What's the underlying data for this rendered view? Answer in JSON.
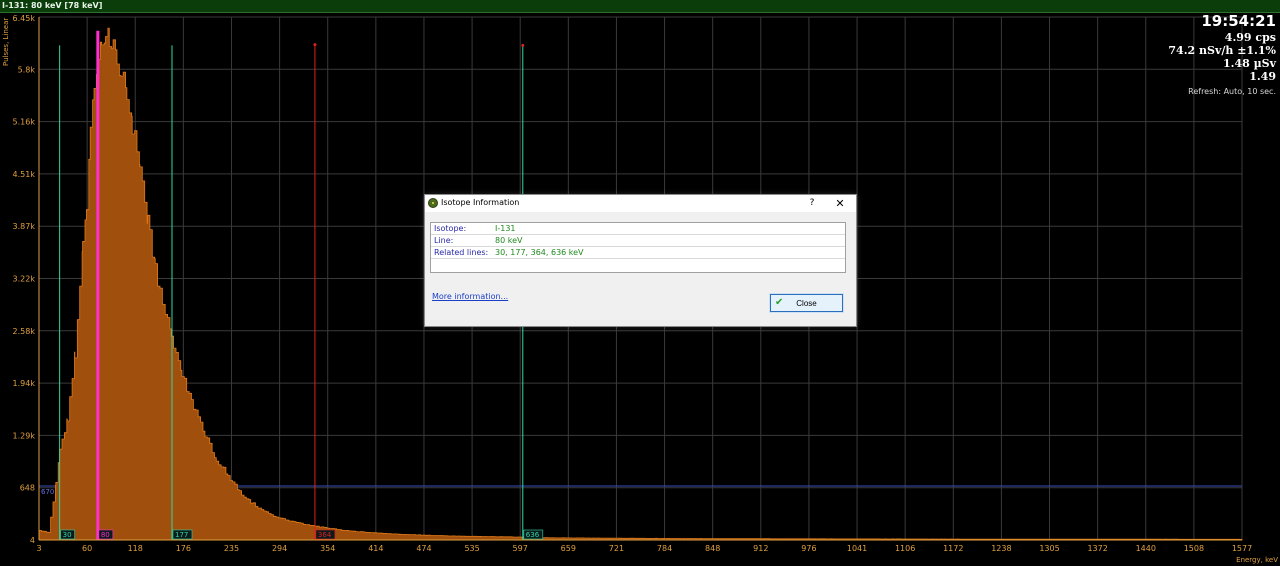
{
  "window": {
    "title": "I-131: 80 keV [78 keV]"
  },
  "stats": {
    "time": "19:54:21",
    "cps": "4.99 cps",
    "dose_rate": "74.2 nSv/h ±1.1%",
    "dose": "1.48 µSv",
    "ratio": "1.49",
    "refresh": "Refresh: Auto, 10 sec."
  },
  "dialog": {
    "title": "Isotope Information",
    "help_label": "?",
    "close_label": "✕",
    "rows": [
      {
        "label": "Isotope:",
        "value": "I-131"
      },
      {
        "label": "Line:",
        "value": "80 keV"
      },
      {
        "label": "Related lines:",
        "value": "30, 177, 364, 636 keV"
      }
    ],
    "more_link": "More information...",
    "close_button": "Close",
    "icon": "radiation-isotope-icon"
  },
  "chart_data": {
    "type": "area",
    "title": "",
    "xlabel": "Energy, keV",
    "ylabel": "Pulses, Linear",
    "xlim": [
      3,
      1577
    ],
    "ylim": [
      4,
      6450
    ],
    "x_ticks": [
      "3",
      "60",
      "118",
      "176",
      "235",
      "294",
      "354",
      "414",
      "474",
      "535",
      "597",
      "659",
      "721",
      "784",
      "848",
      "912",
      "976",
      "1041",
      "1106",
      "1172",
      "1238",
      "1305",
      "1372",
      "1440",
      "1508",
      "1577"
    ],
    "y_ticks": [
      "4",
      "648",
      "1.29k",
      "1.94k",
      "2.58k",
      "3.22k",
      "3.87k",
      "4.51k",
      "5.16k",
      "5.8k",
      "6.45k"
    ],
    "grid": true,
    "series": [
      {
        "values_x": [
          3,
          15,
          25,
          30,
          40,
          50,
          60,
          65,
          70,
          75,
          80,
          85,
          90,
          95,
          100,
          105,
          110,
          118,
          125,
          135,
          145,
          155,
          165,
          176,
          190,
          205,
          220,
          235,
          250,
          265,
          280,
          294,
          310,
          330,
          354,
          380,
          414,
          445,
          474,
          535,
          597,
          636,
          659,
          721,
          784,
          848,
          912,
          976,
          1041,
          1106,
          1172,
          1238,
          1305,
          1372,
          1440,
          1508,
          1577
        ],
        "values_y": [
          120,
          100,
          700,
          1100,
          1500,
          2300,
          3600,
          4200,
          4950,
          5500,
          5950,
          6250,
          6300,
          6200,
          6150,
          6000,
          5800,
          5500,
          5100,
          4500,
          3900,
          3350,
          2900,
          2550,
          2050,
          1650,
          1300,
          1000,
          800,
          600,
          470,
          380,
          300,
          240,
          190,
          150,
          110,
          90,
          75,
          55,
          45,
          40,
          32,
          28,
          25,
          22,
          20,
          19,
          18,
          17,
          16,
          15,
          15,
          14,
          14,
          13,
          12
        ]
      }
    ],
    "markers": [
      {
        "energy": 30,
        "label": "30",
        "color": "#2fd8a8",
        "top_value": 6100,
        "bottom_value": 350
      },
      {
        "energy": 80,
        "label": "80",
        "color": "#ff2fd0",
        "top_value": 6280,
        "bottom_value": 4
      },
      {
        "energy": 177,
        "label": "177",
        "color": "#2fd8a8",
        "top_value": 6100,
        "bottom_value": 4
      },
      {
        "energy": 364,
        "label": "364",
        "color": "#e02020",
        "top_value": 6110,
        "bottom_value": 4
      },
      {
        "energy": 636,
        "label": "636",
        "color": "#2fd8a8",
        "top_value": 6100,
        "bottom_value": 580
      }
    ],
    "threshold": {
      "value": 670,
      "label": "670",
      "color": "#3b4fc0"
    },
    "colors": {
      "fill": "#a04f0c",
      "stroke": "#e07a1a",
      "axis": "#e0a040",
      "grid": "#3a3a3a"
    }
  }
}
